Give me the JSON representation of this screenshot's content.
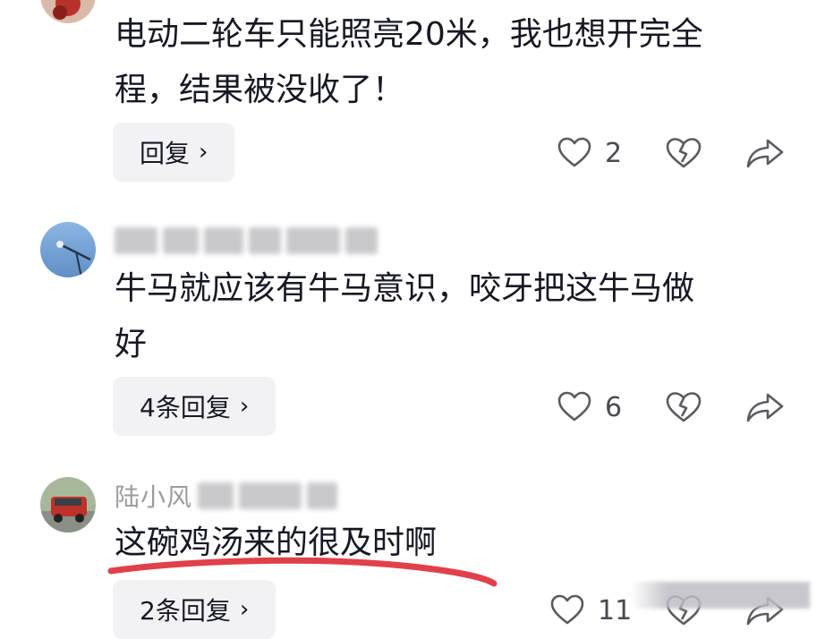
{
  "comments": [
    {
      "text_line1": "电动二轮车只能照亮20米，我也想开完全",
      "text_line2": "程，结果被没收了！",
      "reply_label": "回复",
      "like_count": "2"
    },
    {
      "username": "",
      "text_line1": "牛马就应该有牛马意识，咬牙把这牛马做",
      "text_line2": "好",
      "reply_label": "4条回复",
      "like_count": "6"
    },
    {
      "username": "陆小风",
      "text_line1": "这碗鸡汤来的很及时啊",
      "reply_label": "2条回复",
      "like_count": "11"
    }
  ],
  "icons": {
    "like": "heart-outline-icon",
    "dislike": "broken-heart-icon",
    "share": "share-arrow-icon",
    "reply_chevron": "chevron-right-icon"
  },
  "colors": {
    "text": "#161823",
    "muted": "#9a9aa0",
    "reply_bg": "#f2f2f4",
    "underline": "#e0404a"
  }
}
